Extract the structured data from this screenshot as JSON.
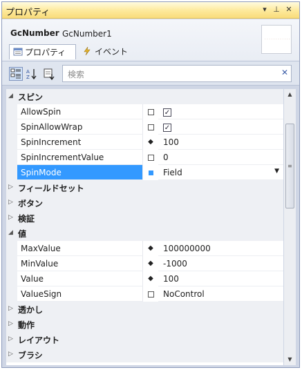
{
  "window": {
    "title": "プロパティ",
    "menu_icon": "dropdown-arrow-icon",
    "pin_icon": "pin-icon",
    "close_icon": "close-icon"
  },
  "header": {
    "object_type": "GcNumber",
    "object_name": "GcNumber1",
    "thumbnail_text": "· · · · · · · · · · · ·"
  },
  "tabs": [
    {
      "label": "プロパティ",
      "icon": "properties-icon",
      "active": true
    },
    {
      "label": "イベント",
      "icon": "lightning-icon",
      "active": false
    }
  ],
  "toolbar": {
    "categorized_icon": "categorized-icon",
    "alphabetical_icon": "alphabetical-icon",
    "property_pages_icon": "property-pages-icon",
    "search_placeholder": "検索",
    "clear_icon": "clear-search-icon"
  },
  "grid": {
    "categories": [
      {
        "label": "スピン",
        "expanded": true,
        "items": [
          {
            "name": "AllowSpin",
            "marker": "box",
            "value": "",
            "check": "✓"
          },
          {
            "name": "SpinAllowWrap",
            "marker": "box",
            "value": "",
            "check": "✓"
          },
          {
            "name": "SpinIncrement",
            "marker": "diamond",
            "value": "100"
          },
          {
            "name": "SpinIncrementValue",
            "marker": "box",
            "value": "0"
          },
          {
            "name": "SpinMode",
            "marker": "box",
            "value": "Field",
            "selected": true,
            "dropdown": true
          }
        ]
      },
      {
        "label": "フィールドセット",
        "expanded": false
      },
      {
        "label": "ボタン",
        "expanded": false
      },
      {
        "label": "検証",
        "expanded": false
      },
      {
        "label": "値",
        "expanded": true,
        "items": [
          {
            "name": "MaxValue",
            "marker": "diamond",
            "value": "100000000"
          },
          {
            "name": "MinValue",
            "marker": "diamond",
            "value": "-1000"
          },
          {
            "name": "Value",
            "marker": "diamond",
            "value": "100"
          },
          {
            "name": "ValueSign",
            "marker": "box",
            "value": "NoControl"
          }
        ]
      },
      {
        "label": "透かし",
        "expanded": false
      },
      {
        "label": "動作",
        "expanded": false
      },
      {
        "label": "レイアウト",
        "expanded": false
      },
      {
        "label": "ブラシ",
        "expanded": false
      }
    ]
  },
  "scrollbar": {
    "position": 0.12
  },
  "colors": {
    "title_bar": "#fde99a",
    "selection": "#3399ff",
    "category_bg": "#eef0f4"
  }
}
